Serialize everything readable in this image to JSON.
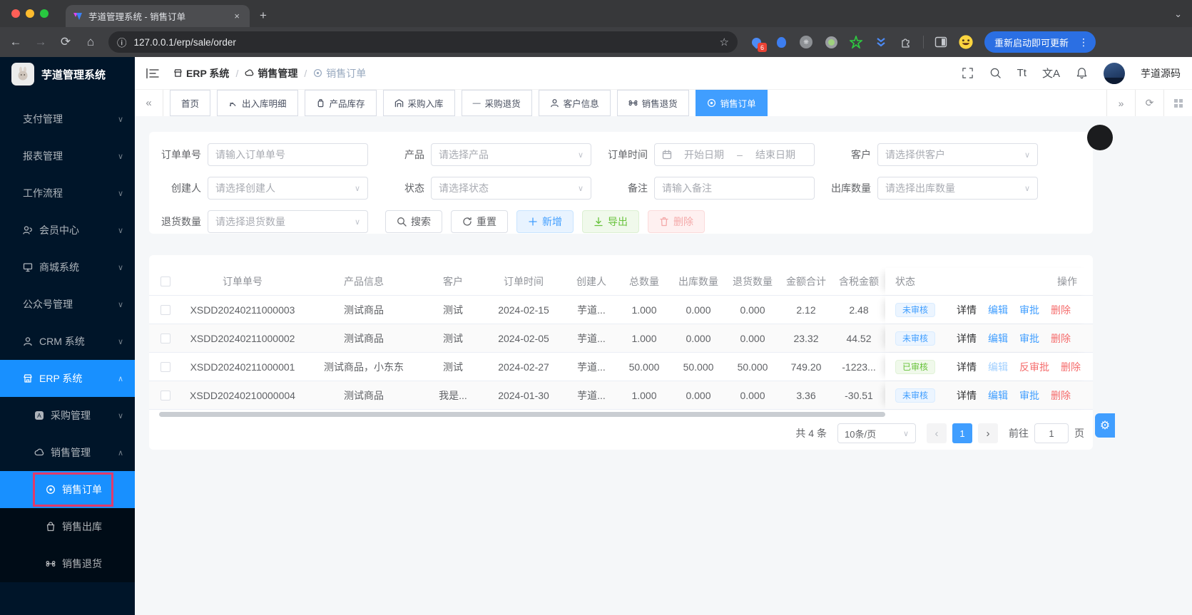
{
  "icons": {
    "back": "←",
    "forward": "→",
    "reload": "⟳",
    "home": "⌂",
    "info": "ⓘ",
    "star": "☆",
    "close": "×",
    "new_tab": "+",
    "tab_search": "⌄",
    "kebab": "⋮",
    "left_scroll": "«",
    "right_scroll": "»",
    "chev_down": "∨",
    "chev_up": "∧",
    "select_arrow": "∨",
    "minus": "—",
    "prev": "‹",
    "next": "›",
    "gear": "⚙",
    "plus": "+",
    "download": "↓",
    "refresh": "⟳",
    "font_size": "Tt",
    "translate": "文A",
    "breadcrumb_sep": "/"
  },
  "browser": {
    "tab_title": "芋道管理系统 - 销售订单",
    "url": "127.0.0.1/erp/sale/order",
    "extension_badge": "6",
    "update_button": "重新启动即可更新"
  },
  "sidebar": {
    "logo_title": "芋道管理系统",
    "items": [
      {
        "label": "支付管理"
      },
      {
        "label": "报表管理"
      },
      {
        "label": "工作流程"
      },
      {
        "label": "会员中心"
      },
      {
        "label": "商城系统"
      },
      {
        "label": "公众号管理"
      },
      {
        "label": "CRM 系统"
      },
      {
        "label": "ERP 系统"
      },
      {
        "label": "采购管理"
      },
      {
        "label": "销售管理"
      },
      {
        "label": "销售订单"
      },
      {
        "label": "销售出库"
      },
      {
        "label": "销售退货"
      }
    ]
  },
  "breadcrumb": {
    "items": [
      {
        "label": "ERP 系统"
      },
      {
        "label": "销售管理"
      },
      {
        "label": "销售订单"
      }
    ]
  },
  "header": {
    "username": "芋道源码"
  },
  "tabsbar": {
    "tabs": [
      {
        "label": "首页"
      },
      {
        "label": "出入库明细"
      },
      {
        "label": "产品库存"
      },
      {
        "label": "采购入库"
      },
      {
        "label": "采购退货"
      },
      {
        "label": "客户信息"
      },
      {
        "label": "销售退货"
      },
      {
        "label": "销售订单"
      }
    ]
  },
  "filters": {
    "order_no": {
      "label": "订单单号",
      "placeholder": "请输入订单单号"
    },
    "product": {
      "label": "产品",
      "placeholder": "请选择产品"
    },
    "order_time": {
      "label": "订单时间",
      "start": "开始日期",
      "separator": "–",
      "end": "结束日期"
    },
    "customer": {
      "label": "客户",
      "placeholder": "请选择供客户"
    },
    "creator": {
      "label": "创建人",
      "placeholder": "请选择创建人"
    },
    "status": {
      "label": "状态",
      "placeholder": "请选择状态"
    },
    "remark": {
      "label": "备注",
      "placeholder": "请输入备注"
    },
    "out_count": {
      "label": "出库数量",
      "placeholder": "请选择出库数量"
    },
    "return_count": {
      "label": "退货数量",
      "placeholder": "请选择退货数量"
    },
    "buttons": {
      "search": "搜索",
      "reset": "重置",
      "add": "新增",
      "export": "导出",
      "delete": "删除"
    }
  },
  "table": {
    "columns": {
      "order_no": "订单单号",
      "product": "产品信息",
      "customer": "客户",
      "time": "订单时间",
      "creator": "创建人",
      "total": "总数量",
      "out": "出库数量",
      "ret": "退货数量",
      "amount": "金额合计",
      "tax": "含税金额",
      "status": "状态",
      "ops": "操作"
    },
    "rows": [
      {
        "order_no": "XSDD20240211000003",
        "product": "测试商品",
        "customer": "测试",
        "time": "2024-02-15",
        "creator": "芋道...",
        "total": "1.000",
        "out": "0.000",
        "ret": "0.000",
        "amount": "2.12",
        "tax": "2.48",
        "status": "未审核",
        "a1": "详情",
        "a2": "编辑",
        "a3": "审批",
        "a4": "删除"
      },
      {
        "order_no": "XSDD20240211000002",
        "product": "测试商品",
        "customer": "测试",
        "time": "2024-02-05",
        "creator": "芋道...",
        "total": "1.000",
        "out": "0.000",
        "ret": "0.000",
        "amount": "23.32",
        "tax": "44.52",
        "status": "未审核",
        "a1": "详情",
        "a2": "编辑",
        "a3": "审批",
        "a4": "删除"
      },
      {
        "order_no": "XSDD20240211000001",
        "product": "测试商品，小东东",
        "customer": "测试",
        "time": "2024-02-27",
        "creator": "芋道...",
        "total": "50.000",
        "out": "50.000",
        "ret": "50.000",
        "amount": "749.20",
        "tax": "-1223...",
        "status": "已审核",
        "a1": "详情",
        "a2": "编辑",
        "a3": "反审批",
        "a4": "删除"
      },
      {
        "order_no": "XSDD20240210000004",
        "product": "测试商品",
        "customer": "我是...",
        "time": "2024-01-30",
        "creator": "芋道...",
        "total": "1.000",
        "out": "0.000",
        "ret": "0.000",
        "amount": "3.36",
        "tax": "-30.51",
        "status": "未审核",
        "a1": "详情",
        "a2": "编辑",
        "a3": "审批",
        "a4": "删除"
      }
    ]
  },
  "pagination": {
    "total": "共 4 条",
    "size": "10条/页",
    "page": "1",
    "goto": "前往",
    "goto_value": "1",
    "unit": "页"
  },
  "colors": {
    "primary": "#409eff",
    "sidebar_active": "#1890ff",
    "success": "#67c23a",
    "danger": "#f56c6c",
    "highlight_box": "#e03a6b",
    "tag_blue_bg": "#ecf5ff",
    "tag_green_bg": "#f0f9eb"
  }
}
